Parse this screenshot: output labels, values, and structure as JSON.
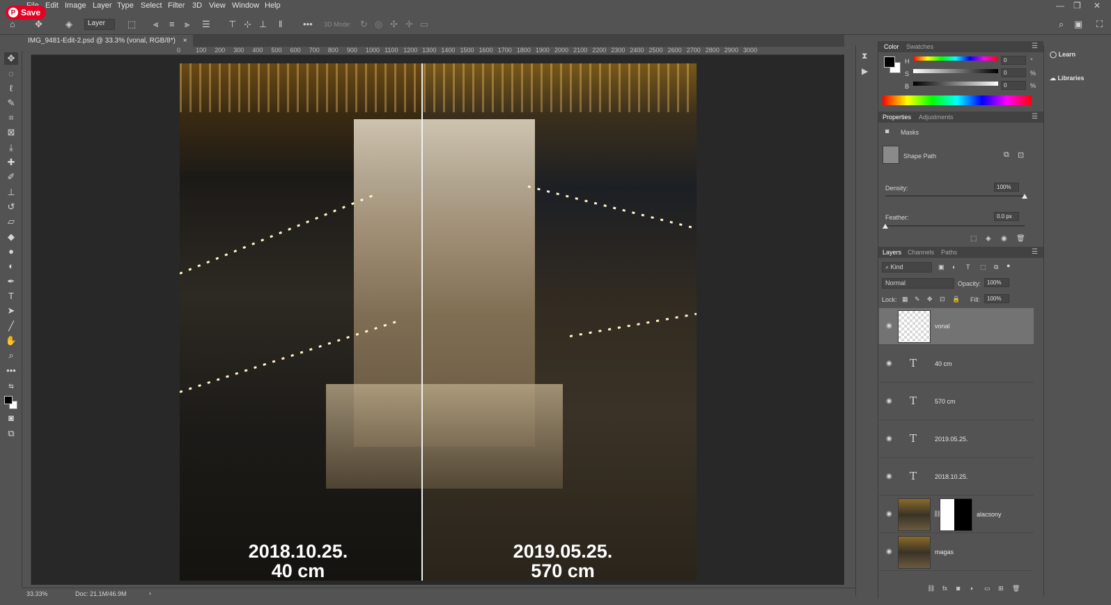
{
  "pinterest": {
    "save_label": "Save"
  },
  "menu": [
    "File",
    "Edit",
    "Image",
    "Layer",
    "Type",
    "Select",
    "Filter",
    "3D",
    "View",
    "Window",
    "Help"
  ],
  "window_controls": [
    "—",
    "❐",
    "✕"
  ],
  "options_bar": {
    "auto_select_target": "Layer",
    "mode_3d_label": "3D Mode:"
  },
  "document": {
    "tab_title": "IMG_9481-Edit-2.psd @ 33.3% (vonal, RGB/8*)",
    "close_glyph": "×"
  },
  "ruler_ticks": [
    "0",
    "100",
    "200",
    "300",
    "400",
    "500",
    "600",
    "700",
    "800",
    "900",
    "1000",
    "1100",
    "1200",
    "1300",
    "1400",
    "1500",
    "1600",
    "1700",
    "1800",
    "1900",
    "2000",
    "2100",
    "2200",
    "2300",
    "2400",
    "2500",
    "2600",
    "2700",
    "2800",
    "2900",
    "3000"
  ],
  "image_captions": {
    "left_date": "2018.10.25.",
    "left_level": "40 cm",
    "right_date": "2019.05.25.",
    "right_level": "570 cm"
  },
  "color_panel": {
    "tabs": [
      "Color",
      "Swatches"
    ],
    "channels": [
      {
        "label": "H",
        "value": "0",
        "unit": "°"
      },
      {
        "label": "S",
        "value": "0",
        "unit": "%"
      },
      {
        "label": "B",
        "value": "0",
        "unit": "%"
      }
    ],
    "foreground": "#000000",
    "background": "#ffffff"
  },
  "properties_panel": {
    "tabs": [
      "Properties",
      "Adjustments"
    ],
    "section_label": "Masks",
    "mask_type": "Shape Path",
    "density_label": "Density:",
    "density_value": "100%",
    "density_level": 1.0,
    "feather_label": "Feather:",
    "feather_value": "0.0 px",
    "feather_level": 0.0
  },
  "layers_panel": {
    "tabs": [
      "Layers",
      "Channels",
      "Paths"
    ],
    "filter_kind": "Kind",
    "blend_mode": "Normal",
    "opacity_label": "Opacity:",
    "opacity_value": "100%",
    "lock_label": "Lock:",
    "fill_label": "Fill:",
    "fill_value": "100%",
    "layers": [
      {
        "name": "vonal",
        "kind": "shape",
        "selected": true
      },
      {
        "name": "40 cm",
        "kind": "text"
      },
      {
        "name": "570 cm",
        "kind": "text"
      },
      {
        "name": "2019.05.25.",
        "kind": "text"
      },
      {
        "name": "2018.10.25.",
        "kind": "text"
      },
      {
        "name": "alacsony",
        "kind": "image-with-mask"
      },
      {
        "name": "magas",
        "kind": "image"
      }
    ],
    "text_glyph": "T"
  },
  "side_column": {
    "learn_label": "Learn",
    "libraries_label": "Libraries"
  },
  "status_bar": {
    "zoom": "33.33%",
    "doc_size": "Doc: 21.1M/46.9M",
    "arrow": "›"
  },
  "colors": {
    "ui_bg": "#535353",
    "canvas_bg": "#282828",
    "panel_header": "#424242",
    "selected_layer": "#737373",
    "pinterest_red": "#e60023"
  }
}
